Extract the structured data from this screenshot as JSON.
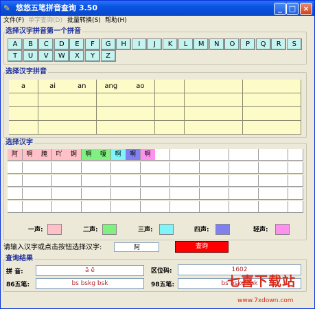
{
  "window": {
    "title": "悠悠五笔拼音查询 3.50",
    "minimize": "_",
    "maximize": "□",
    "close": "×"
  },
  "menu": [
    {
      "label": "文件(F)",
      "disabled": false
    },
    {
      "label": "单字查询(D)",
      "disabled": true
    },
    {
      "label": "批量转换(S)",
      "disabled": false
    },
    {
      "label": "帮助(H)",
      "disabled": false
    }
  ],
  "letters": {
    "title": "选择汉字拼音第一个拼音",
    "items": [
      "A",
      "B",
      "C",
      "D",
      "E",
      "F",
      "G",
      "H",
      "I",
      "J",
      "K",
      "L",
      "M",
      "N",
      "O",
      "P",
      "Q",
      "R",
      "S",
      "T",
      "U",
      "V",
      "W",
      "X",
      "Y",
      "Z"
    ]
  },
  "pinyin": {
    "title": "选择汉字拼音",
    "row1": [
      "a",
      "ai",
      "an",
      "ang",
      "ao",
      "",
      "",
      "",
      "",
      ""
    ]
  },
  "hanzi": {
    "title": "选择汉字",
    "row1": [
      {
        "t": "阿",
        "c": "#ffc0c8"
      },
      {
        "t": "啊",
        "c": "#ffc0c8"
      },
      {
        "t": "腌",
        "c": "#ffc0c8"
      },
      {
        "t": "吖",
        "c": "#ffc0c8"
      },
      {
        "t": "锕",
        "c": "#ffc0c8"
      },
      {
        "t": "啊",
        "c": "#80f080"
      },
      {
        "t": "嗄",
        "c": "#80f080"
      },
      {
        "t": "啊",
        "c": "#80f4f8"
      },
      {
        "t": "啊",
        "c": "#8080f0"
      },
      {
        "t": "啊",
        "c": "#ff90ee"
      }
    ]
  },
  "tones": [
    {
      "label": "一声:",
      "color": "#ffc0c8"
    },
    {
      "label": "二声:",
      "color": "#80f080"
    },
    {
      "label": "三声:",
      "color": "#80f4f8"
    },
    {
      "label": "四声:",
      "color": "#8080f0"
    },
    {
      "label": "轻声:",
      "color": "#ff90ee"
    }
  ],
  "query": {
    "prompt": "请输入汉字或点击按钮选择汉字:",
    "input_value": "阿",
    "button": "查询"
  },
  "results": {
    "title": "查询结果",
    "pinyin_label": "拼 音:",
    "pinyin_value": "ā  ē",
    "quwei_label": "区位码:",
    "quwei_value": "1602",
    "wb86_label": "86五笔:",
    "wb86_value": "bs bskg bsk",
    "wb98_label": "98五笔:",
    "wb98_value": "bs bskg bsk"
  },
  "watermark": {
    "text": "七喜下载站",
    "url": "www.7xdown.com"
  }
}
